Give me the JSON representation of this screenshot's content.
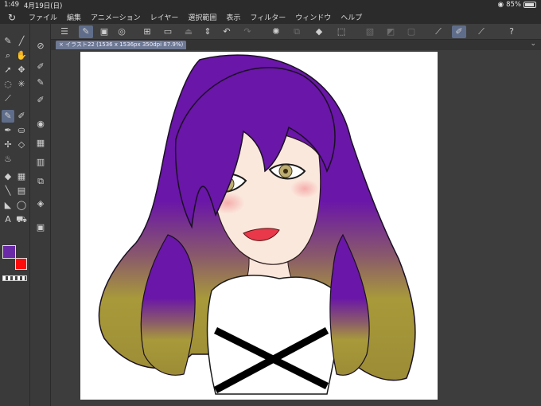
{
  "status": {
    "time": "1:49",
    "date": "4月19日(日)",
    "battery": "85%"
  },
  "menu": [
    "ファイル",
    "編集",
    "アニメーション",
    "レイヤー",
    "選択範囲",
    "表示",
    "フィルター",
    "ウィンドウ",
    "ヘルプ"
  ],
  "document": {
    "tab_title": "イラスト22 (1536 x 1536px 350dpi 87.9%)"
  },
  "colors": {
    "main": "#6a2aa8",
    "sub": "#ff0a0a",
    "accent": "#5f6d8a"
  },
  "commands": [
    "menu-icon",
    "pen-icon",
    "sub-view-icon",
    "new-file-icon",
    "open-icon",
    "save-icon",
    "spinner-icon",
    "undo-icon",
    "redo-icon",
    "clear-icon",
    "fill-icon",
    "transform-icon",
    "layer-mask-icon",
    "stabilize-icon",
    "brush-icon",
    "eyedropper-icon",
    "help-icon"
  ],
  "tools": [
    "pen-icon",
    "magnifier-icon",
    "hand-icon",
    "pointer-icon",
    "move-icon",
    "lasso-icon",
    "sparkle-icon",
    "eyedropper-icon",
    "pencil-icon",
    "brush-icon",
    "eraser-icon",
    "blend-icon",
    "fill-icon",
    "gradient-icon",
    "figure-icon",
    "frame-icon",
    "text-icon",
    "balloon-icon"
  ]
}
